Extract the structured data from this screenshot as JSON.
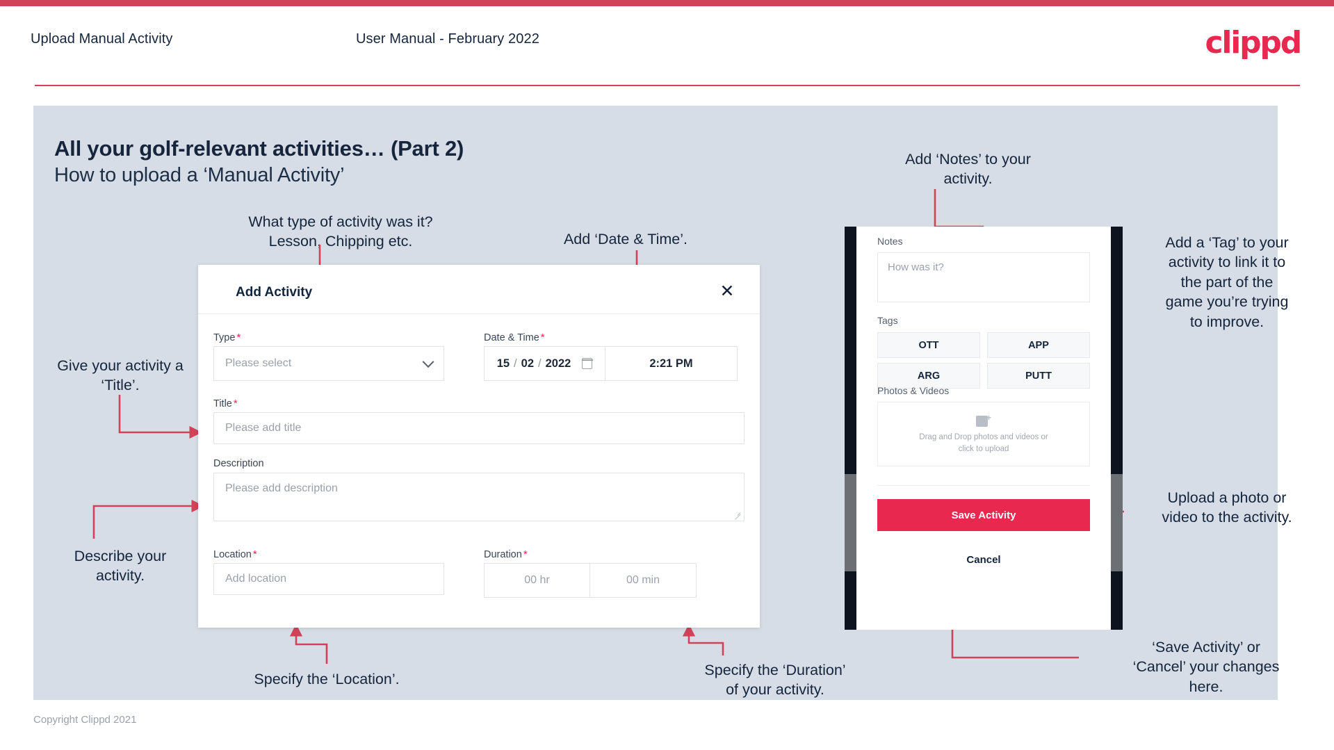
{
  "header": {
    "left_title": "Upload Manual Activity",
    "center_title": "User Manual - February 2022",
    "logo": "clippd"
  },
  "slide": {
    "title_main": "All your golf-relevant activities… (Part 2)",
    "title_sub": "How to upload a ‘Manual Activity’"
  },
  "annotations": {
    "type": "What type of activity was it?\nLesson, Chipping etc.",
    "datetime": "Add ‘Date & Time’.",
    "title": "Give your activity a\n‘Title’.",
    "description": "Describe your\nactivity.",
    "location": "Specify the ‘Location’.",
    "duration": "Specify the ‘Duration’\nof your activity.",
    "notes": "Add ‘Notes’ to your\nactivity.",
    "tags": "Add a ‘Tag’ to your\nactivity to link it to\nthe part of the\ngame you’re trying\nto improve.",
    "upload": "Upload a photo or\nvideo to the activity.",
    "save_cancel": "‘Save Activity’ or\n‘Cancel’ your changes\nhere."
  },
  "dialog": {
    "title": "Add Activity",
    "close_icon": "close-icon",
    "fields": {
      "type_label": "Type",
      "type_placeholder": "Please select",
      "datetime_label": "Date & Time",
      "date_day": "15",
      "date_month": "02",
      "date_year": "2022",
      "date_sep": "/",
      "time_value": "2:21 PM",
      "title_label": "Title",
      "title_placeholder": "Please add title",
      "description_label": "Description",
      "description_placeholder": "Please add description",
      "location_label": "Location",
      "location_placeholder": "Add location",
      "duration_label": "Duration",
      "duration_hours": "00 hr",
      "duration_minutes": "00 min"
    },
    "required_mark": "*"
  },
  "phone": {
    "notes_label": "Notes",
    "notes_placeholder": "How was it?",
    "tags_label": "Tags",
    "tags": [
      "OTT",
      "APP",
      "ARG",
      "PUTT"
    ],
    "photos_label": "Photos & Videos",
    "drop_text": "Drag and Drop photos and videos or\nclick to upload",
    "save_button": "Save Activity",
    "cancel_button": "Cancel"
  },
  "footer": {
    "copyright": "Copyright Clippd 2021"
  },
  "colors": {
    "brand_pink": "#e8284f",
    "accent_bar": "#cf4257",
    "slide_bg": "#d7dde6",
    "text_dark": "#14243b",
    "arrow": "#cf4257"
  }
}
